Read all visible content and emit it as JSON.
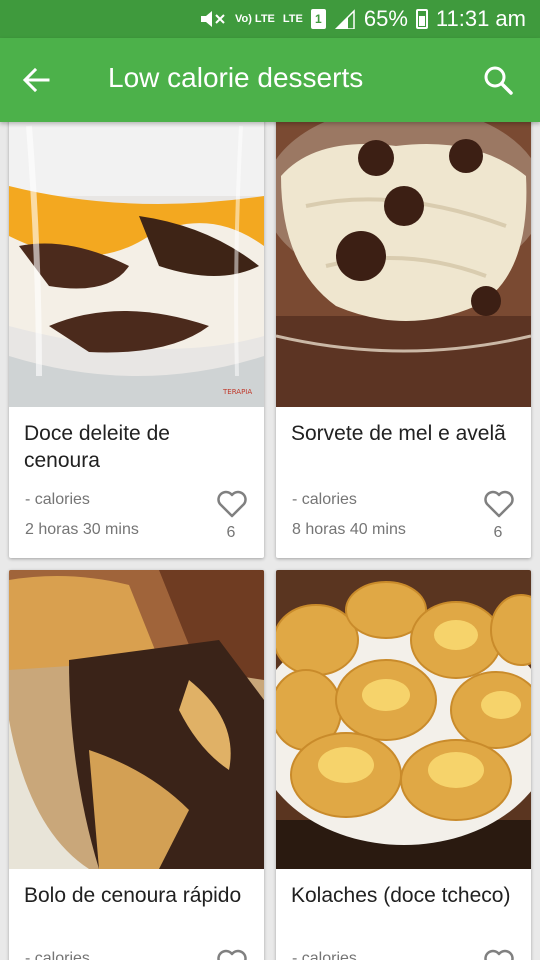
{
  "status_bar": {
    "battery": "65%",
    "time": "11:31 am",
    "network": "LTE",
    "volte": "Vo) LTE",
    "sim": "1"
  },
  "header": {
    "title": "Low calorie desserts"
  },
  "recipes": [
    {
      "name": "Doce deleite de cenoura",
      "calories": "- calories",
      "time": "2 horas 30 mins",
      "likes": "6",
      "watermark": "TERAPIA"
    },
    {
      "name": "Sorvete de mel e avelã",
      "calories": "- calories",
      "time": "8 horas 40 mins",
      "likes": "6"
    },
    {
      "name": "Bolo de cenoura rápido",
      "calories": "- calories"
    },
    {
      "name": "Kolaches (doce tcheco)",
      "calories": "- calories"
    }
  ],
  "colors": {
    "status_bar": "#3f9a3d",
    "app_bar": "#4cb14a",
    "background": "#e9e9e9"
  }
}
